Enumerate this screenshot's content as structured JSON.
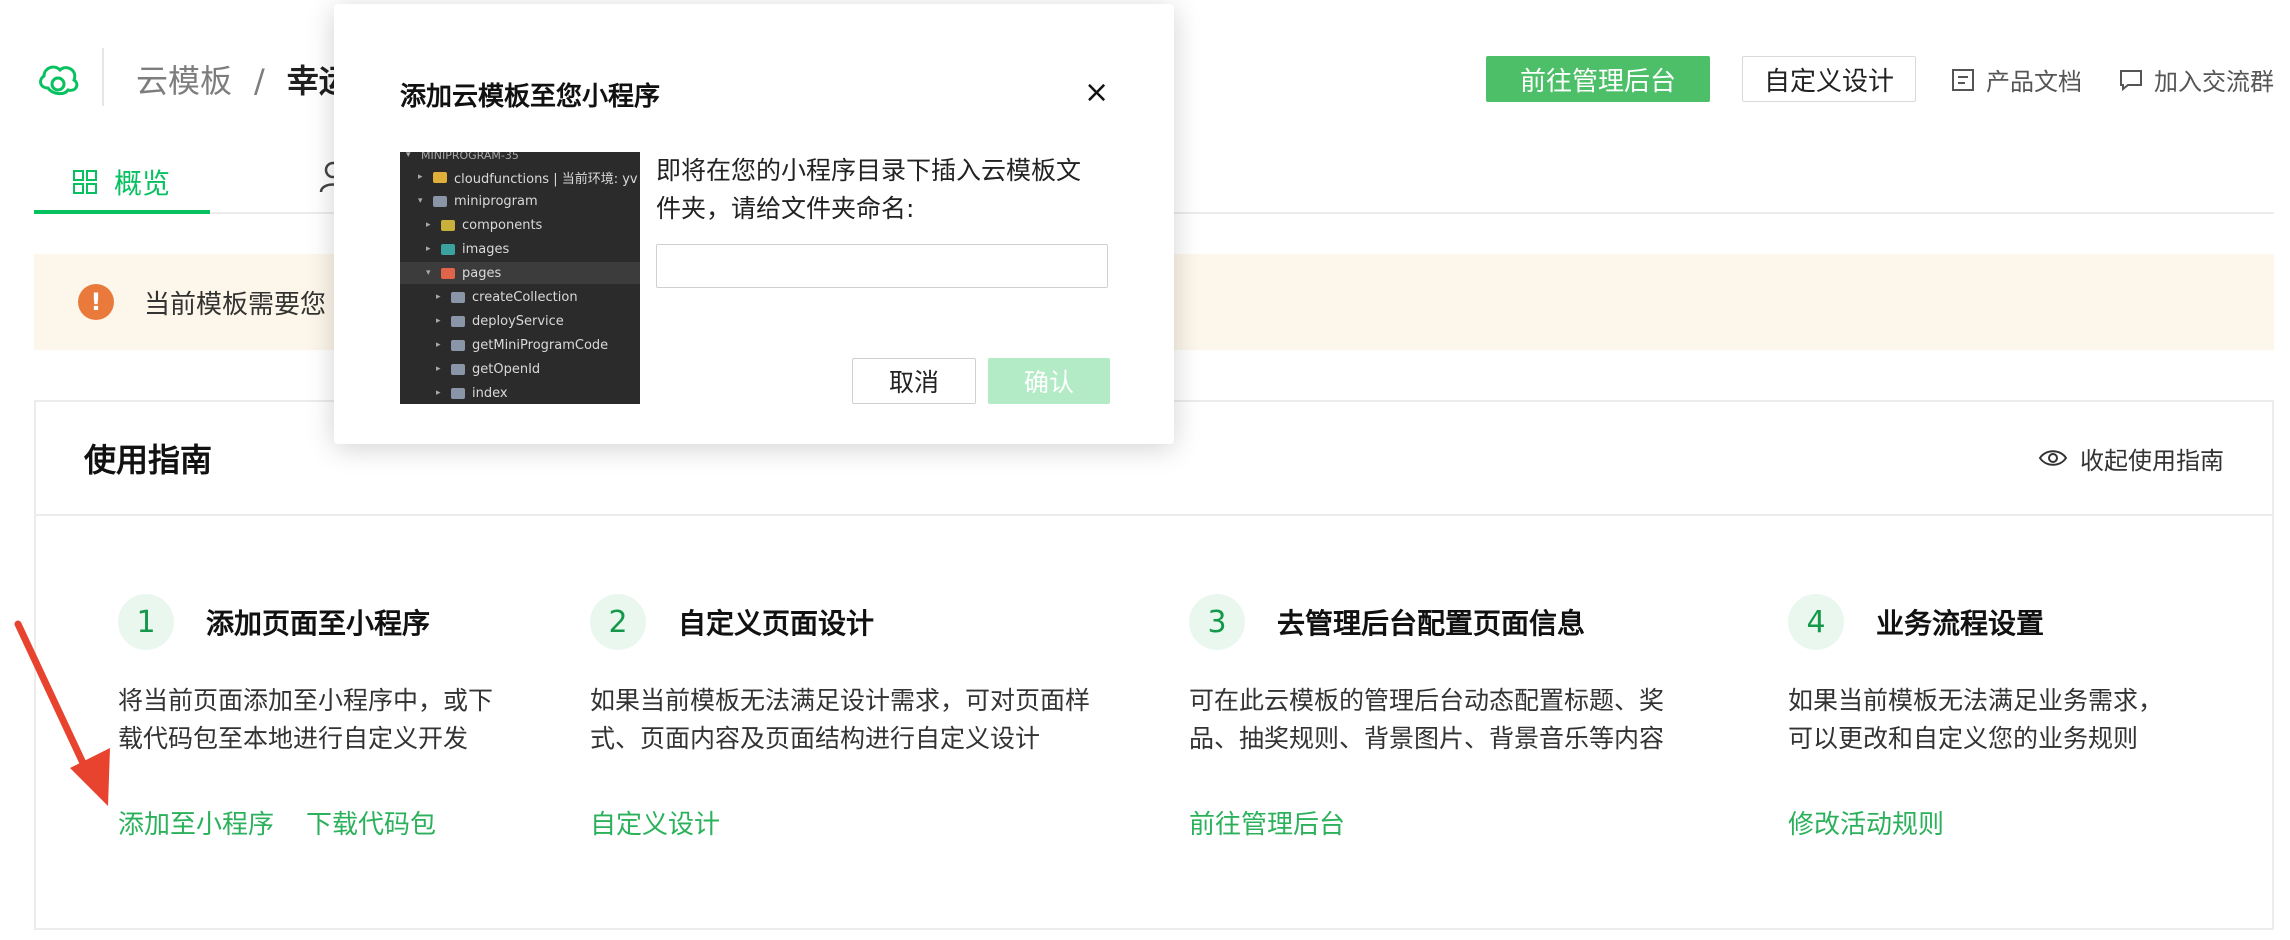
{
  "header": {
    "breadcrumb_root": "云模板",
    "breadcrumb_sep": "/",
    "breadcrumb_current": "幸运",
    "admin_button": "前往管理后台",
    "custom_design_button": "自定义设计",
    "docs_link": "产品文档",
    "group_link": "加入交流群"
  },
  "tabs": [
    {
      "label": "概览",
      "active": true
    }
  ],
  "notice": {
    "text": "当前模板需要您"
  },
  "guide": {
    "title": "使用指南",
    "collapse_label": "收起使用指南",
    "steps": [
      {
        "num": "1",
        "title": "添加页面至小程序",
        "desc_line1": "将当前页面添加至小程序中，或下",
        "desc_line2": "载代码包至本地进行自定义开发",
        "links": [
          "添加至小程序",
          "下载代码包"
        ]
      },
      {
        "num": "2",
        "title": "自定义页面设计",
        "desc_line1": "如果当前模板无法满足设计需求，可对页面样",
        "desc_line2": "式、页面内容及页面结构进行自定义设计",
        "links": [
          "自定义设计"
        ]
      },
      {
        "num": "3",
        "title": "去管理后台配置页面信息",
        "desc_line1": "可在此云模板的管理后台动态配置标题、奖",
        "desc_line2": "品、抽奖规则、背景图片、背景音乐等内容",
        "links": [
          "前往管理后台"
        ]
      },
      {
        "num": "4",
        "title": "业务流程设置",
        "desc_line1": "如果当前模板无法满足业务需求，",
        "desc_line2": "可以更改和自定义您的业务规则",
        "links": [
          "修改活动规则"
        ]
      }
    ]
  },
  "modal": {
    "title": "添加云模板至您小程序",
    "close": "×",
    "desc_line1": "即将在您的小程序目录下插入云模板文",
    "desc_line2": "件夹，请给文件夹命名:",
    "input_value": "",
    "input_placeholder": "",
    "cancel": "取消",
    "confirm": "确认",
    "tree": [
      "MINIPROGRAM-35",
      "cloudfunctions | 当前环境: yv",
      "miniprogram",
      "components",
      "images",
      "pages",
      "createCollection",
      "deployService",
      "getMiniProgramCode",
      "getOpenId",
      "index"
    ]
  },
  "colors": {
    "brand": "#07c160",
    "link": "#2bb15b",
    "notice_bg": "#fdf6ea",
    "notice_icon": "#e97a3c",
    "arrow": "#e8432e",
    "confirm_disabled": "#b3ebc6"
  }
}
